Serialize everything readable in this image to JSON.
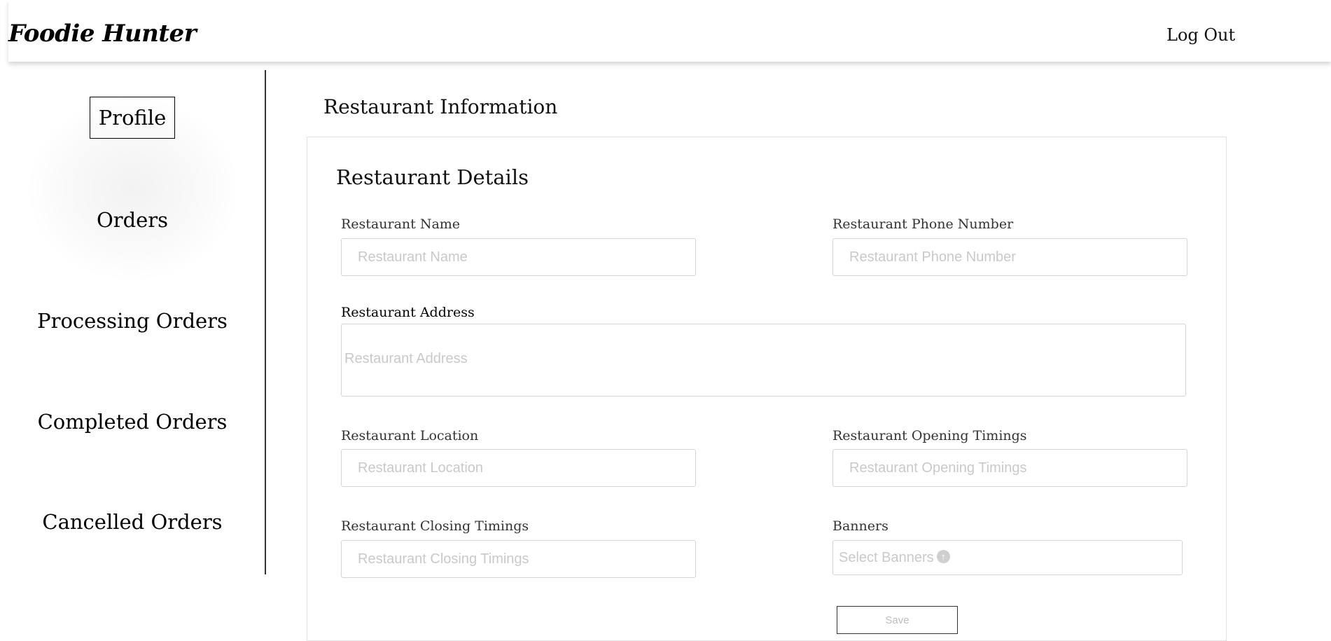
{
  "header": {
    "logo": "Foodie Hunter",
    "logout_label": "Log Out"
  },
  "sidebar": {
    "items": [
      {
        "label": "Profile",
        "active": true
      },
      {
        "label": "Orders"
      },
      {
        "label": "Processing Orders"
      },
      {
        "label": "Completed Orders"
      },
      {
        "label": "Cancelled Orders"
      }
    ]
  },
  "main": {
    "title": "Restaurant Information",
    "card_title": "Restaurant Details",
    "fields": {
      "name": {
        "label": "Restaurant Name",
        "placeholder": "Restaurant Name"
      },
      "phone": {
        "label": "Restaurant Phone Number",
        "placeholder": "Restaurant Phone Number"
      },
      "address": {
        "label": "Restaurant Address",
        "placeholder": "Restaurant Address"
      },
      "location": {
        "label": "Restaurant Location",
        "placeholder": "Restaurant Location"
      },
      "opening": {
        "label": "Restaurant Opening Timings",
        "placeholder": "Restaurant Opening Timings"
      },
      "closing": {
        "label": "Restaurant Closing Timings",
        "placeholder": "Restaurant Closing Timings"
      },
      "banners": {
        "label": "Banners",
        "placeholder": "Select Banners",
        "icon": "upload-icon"
      }
    },
    "save_label": "Save"
  }
}
